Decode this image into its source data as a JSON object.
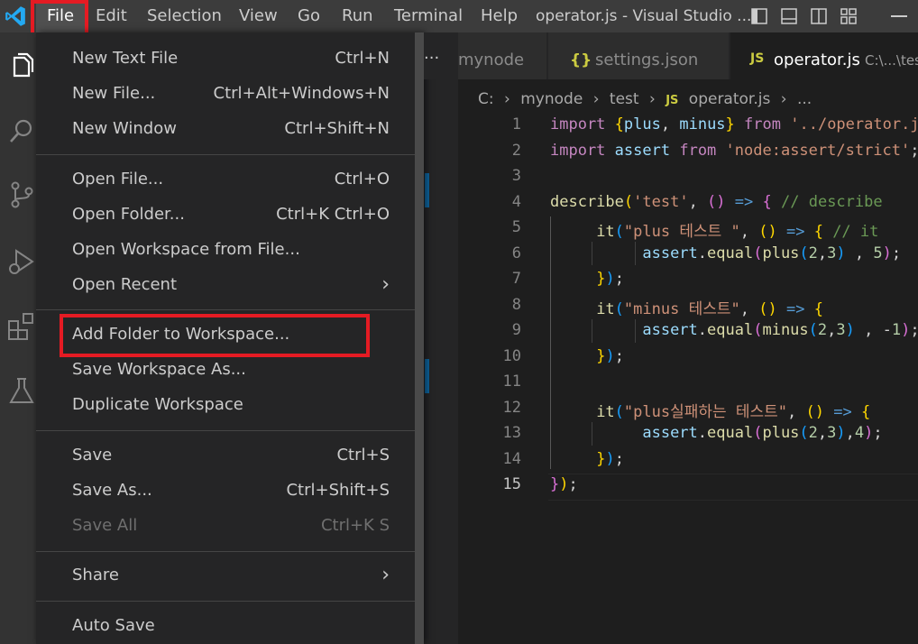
{
  "titlebar": {
    "menus": [
      "File",
      "Edit",
      "Selection",
      "View",
      "Go",
      "Run",
      "Terminal",
      "Help"
    ],
    "title": "operator.js - Visual Studio ..."
  },
  "file_menu": {
    "items": [
      {
        "label": "New Text File",
        "shortcut": "Ctrl+N"
      },
      {
        "label": "New File...",
        "shortcut": "Ctrl+Alt+Windows+N"
      },
      {
        "label": "New Window",
        "shortcut": "Ctrl+Shift+N"
      },
      {
        "label": "Open File...",
        "shortcut": "Ctrl+O"
      },
      {
        "label": "Open Folder...",
        "shortcut": "Ctrl+K Ctrl+O"
      },
      {
        "label": "Open Workspace from File...",
        "shortcut": ""
      },
      {
        "label": "Open Recent",
        "shortcut": ""
      },
      {
        "label": "Add Folder to Workspace...",
        "shortcut": ""
      },
      {
        "label": "Save Workspace As...",
        "shortcut": ""
      },
      {
        "label": "Duplicate Workspace",
        "shortcut": ""
      },
      {
        "label": "Save",
        "shortcut": "Ctrl+S"
      },
      {
        "label": "Save As...",
        "shortcut": "Ctrl+Shift+S"
      },
      {
        "label": "Save All",
        "shortcut": "Ctrl+K S"
      },
      {
        "label": "Share",
        "shortcut": ""
      },
      {
        "label": "Auto Save",
        "shortcut": ""
      }
    ]
  },
  "tabs": {
    "overflow": "···",
    "tab1": "mynode",
    "tab2_icon": "{}",
    "tab2": "settings.json",
    "tab3_icon": "JS",
    "tab3": "operator.js",
    "tab3_path": "C:\\...\\test"
  },
  "breadcrumb": {
    "parts": [
      "C:",
      "mynode",
      "test"
    ],
    "file_icon": "JS",
    "file": "operator.js",
    "more": "..."
  },
  "editor": {
    "line_numbers": [
      "1",
      "2",
      "3",
      "4",
      "5",
      "6",
      "7",
      "8",
      "9",
      "10",
      "11",
      "12",
      "13",
      "14",
      "15"
    ],
    "current_line": "15"
  },
  "colors": {
    "accent": "#0e639c",
    "highlight": "#e51b23",
    "vscode_blue": "#23a9f2"
  }
}
